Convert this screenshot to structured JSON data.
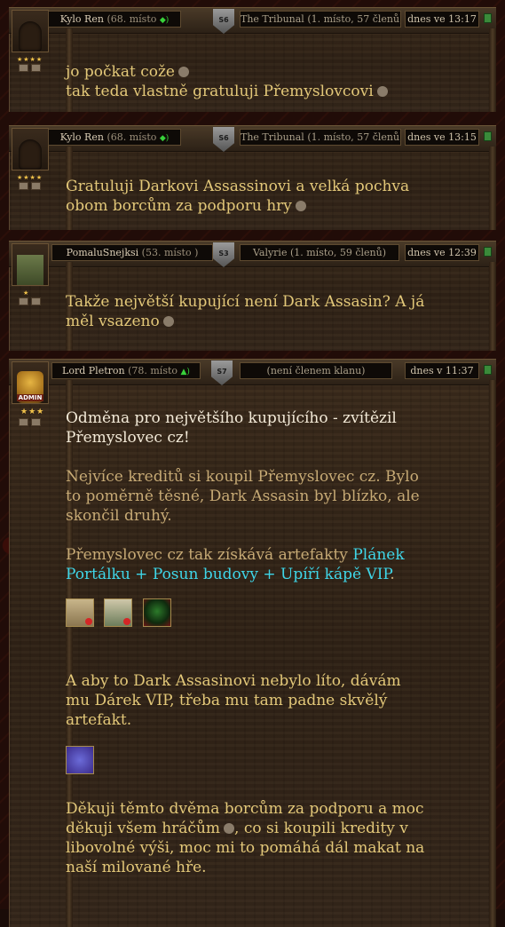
{
  "posts": [
    {
      "author": "Kylo Ren",
      "rank": "(68. místo",
      "server": "S6",
      "clan": "The Tribunal (1. místo, 57 členů)",
      "date": "dnes ve 13:17",
      "lines": [
        "jo počkat cože",
        "tak teda vlastně gratuluji Přemyslovcovi"
      ]
    },
    {
      "author": "Kylo Ren",
      "rank": "(68. místo",
      "server": "S6",
      "clan": "The Tribunal (1. místo, 57 členů)",
      "date": "dnes ve 13:15",
      "lines": [
        "Gratuluji Darkovi Assassinovi a velká pochva",
        "obom borcům za podporu hry"
      ]
    },
    {
      "author": "PomaluSnejksi",
      "rank": "(53. místo )",
      "server": "S3",
      "clan": "Valyrie (1. místo, 59 členů)",
      "date": "dnes ve 12:39",
      "lines": [
        "Takže největší kupující není Dark Assasin? A já",
        "měl vsazeno"
      ]
    },
    {
      "author": "Lord Pletron",
      "rank": "(78. místo",
      "server": "S7",
      "clan": "(není členem klanu)",
      "date": "dnes v 11:37",
      "admin_tag": "ADMIN",
      "heading": [
        "Odměna pro největšího kupujícího - zvítězil",
        "Přemyslovec cz!"
      ],
      "para1": [
        "Nejvíce kreditů si koupil Přemyslovec cz. Bylo",
        "to poměrně těsné, Dark Assasin byl blízko, ale",
        "skončil druhý."
      ],
      "para2_prefix": "Přemyslovec cz tak získává artefakty ",
      "para2_highlight_1": "Plánek",
      "para2_highlight_2": "Portálku + Posun budovy + Upíří kápě VIP",
      "para2_suffix": ".",
      "para3": [
        "A aby to Dark Assasinovi nebylo líto, dávám",
        "mu Dárek VIP, třeba mu tam padne skvělý",
        "artefakt."
      ],
      "para4_line1": "Děkuji těmto dvěma borcům za podporu a moc",
      "para4_line2a": "děkuji všem hráčům",
      "para4_line2b": ", co si koupili kredity v",
      "para4_line3": "libovolné výši, moc mi to pomáhá dál makat na",
      "para4_line4": "naší milované hře."
    }
  ],
  "stars": {
    "post1": "★★★★",
    "post2": "★★★★",
    "post3": "★",
    "post4": "★★★"
  },
  "colors": {
    "body_text": "#e3c879",
    "highlight": "#3fd6e8",
    "heading": "#f3ead8"
  }
}
